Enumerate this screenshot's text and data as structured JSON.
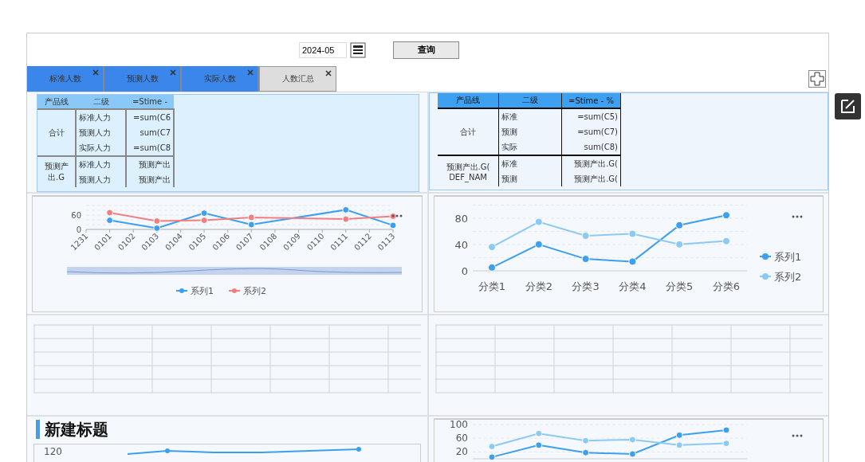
{
  "toolbar": {
    "date_value": "2024-05",
    "query_button": "查询"
  },
  "tabs": [
    {
      "label": "标准人数",
      "selected": false
    },
    {
      "label": "预测人数",
      "selected": false
    },
    {
      "label": "实际人数",
      "selected": false
    },
    {
      "label": "人数汇总",
      "selected": true
    }
  ],
  "table_1": {
    "columns": [
      "产品线",
      "二级",
      "=Stime -"
    ],
    "groups": [
      {
        "label_lines": [
          "合计"
        ],
        "rows": [
          [
            "标准人力",
            "=sum(C6"
          ],
          [
            "预测人力",
            "sum(C7"
          ],
          [
            "实际人力",
            "=sum(C8"
          ]
        ]
      },
      {
        "label_lines": [
          "预测产",
          "出.G"
        ],
        "rows": [
          [
            "标准人力",
            "预测产出"
          ],
          [
            "预测人力",
            "预测产出"
          ]
        ]
      }
    ]
  },
  "table_2": {
    "columns": [
      "产品线",
      "二级",
      "=Stime - %"
    ],
    "groups": [
      {
        "label_lines": [
          "合计"
        ],
        "rows": [
          [
            "标准",
            "=sum(C5)"
          ],
          [
            "预测",
            "=sum(C7)"
          ],
          [
            "实际",
            "sum(C8)"
          ]
        ]
      },
      {
        "label_lines": [
          "预测产出.G(",
          "DEF_NAM"
        ],
        "rows": [
          [
            "标准",
            "预测产出.G("
          ],
          [
            "预测",
            "预测产出.G("
          ]
        ]
      }
    ]
  },
  "chart_1": {
    "chart_data": {
      "type": "line",
      "legend": "bottom",
      "categories": [
        "1231",
        "0101",
        "0102",
        "0103",
        "0104",
        "0105",
        "0106",
        "0107",
        "0108",
        "0109",
        "0110",
        "0111",
        "0112",
        "0113"
      ],
      "ylim": [
        0,
        100
      ],
      "yticks": [
        0,
        60
      ],
      "series": [
        {
          "name": "系列1",
          "color": "#3d9ff0",
          "marker": true,
          "values": [
            null,
            38,
            null,
            5,
            null,
            68,
            null,
            20,
            null,
            null,
            null,
            82,
            null,
            17
          ]
        },
        {
          "name": "系列2",
          "color": "#f08080",
          "marker": true,
          "values": [
            null,
            70,
            null,
            35,
            null,
            38,
            null,
            50,
            null,
            null,
            null,
            43,
            null,
            55
          ]
        }
      ]
    }
  },
  "chart_2": {
    "chart_data": {
      "type": "line",
      "legend": "right",
      "categories": [
        "分类1",
        "分类2",
        "分类3",
        "分类4",
        "分类5",
        "分类6"
      ],
      "ylim": [
        0,
        100
      ],
      "yticks": [
        0,
        40,
        80
      ],
      "series": [
        {
          "name": "系列1",
          "color": "#3d9ff0",
          "marker": true,
          "values": [
            5,
            40,
            18,
            14,
            69,
            84
          ]
        },
        {
          "name": "系列2",
          "color": "#8ccaf4",
          "marker": true,
          "values": [
            36,
            74,
            53,
            56,
            40,
            45
          ]
        }
      ]
    }
  },
  "section_title": "新建标题",
  "chart_3": {
    "ytick": "120"
  },
  "chart_4": {
    "chart_data": {
      "type": "line",
      "ylim": [
        0,
        100
      ],
      "yticks": [
        20,
        60,
        100
      ],
      "series": [
        {
          "color": "#3d9ff0",
          "marker": true,
          "values": [
            5,
            40,
            18,
            14,
            69,
            84
          ]
        },
        {
          "color": "#8ccaf4",
          "marker": true,
          "values": [
            36,
            74,
            53,
            56,
            40,
            45
          ]
        }
      ]
    }
  }
}
